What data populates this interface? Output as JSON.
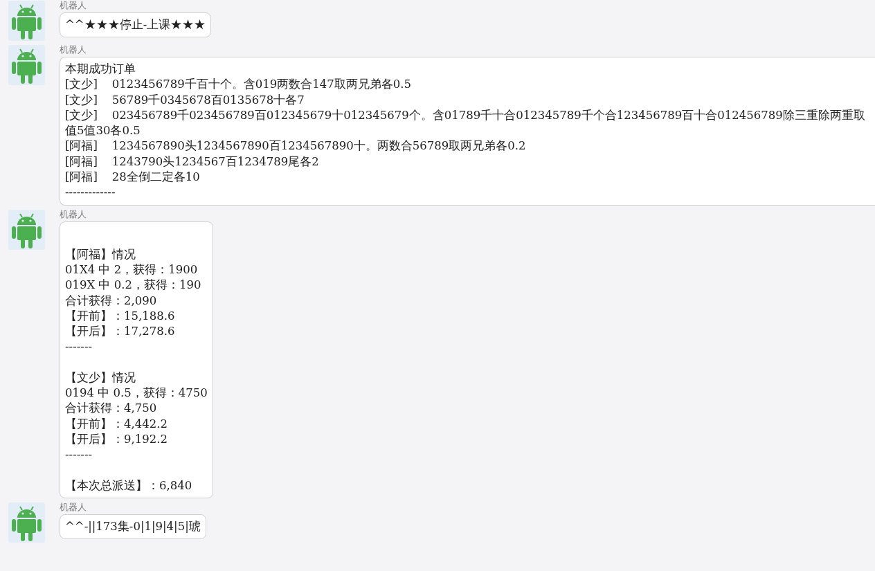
{
  "messages": [
    {
      "sender": "机器人",
      "kind": "text",
      "sections": [
        [
          "^^★★★停止-上课★★★"
        ]
      ]
    },
    {
      "sender": "机器人",
      "kind": "wide",
      "sections": [
        [
          "本期成功订单",
          "[文少]    0123456789千百十个。含019两数合147取两兄弟各0.5",
          "[文少]    56789千0345678百0135678十各7",
          "[文少]    023456789千023456789百012345679十012345679个。含01789千十合012345789千个合123456789百十合012456789除三重除两重取值5值30各0.5",
          "[阿福]    1234567890头1234567890百1234567890十。两数合56789取两兄弟各0.2",
          "[阿福]    1243790头1234567百1234789尾各2",
          "[阿福]    28全倒二定各10",
          "-------------"
        ]
      ]
    },
    {
      "sender": "机器人",
      "kind": "report",
      "sections": [
        [
          "【阿福】情况",
          "01X4 中 2，获得：1900",
          "019X 中 0.2，获得：190",
          "合计获得：2,090",
          "【开前】：15,188.6",
          "【开后】：17,278.6",
          "-------"
        ],
        [
          "【文少】情况",
          "0194 中 0.5，获得：4750",
          "合计获得：4,750",
          "【开前】：4,442.2",
          "【开后】：9,192.2",
          "-------"
        ],
        [
          "【本次总派送】：6,840"
        ]
      ]
    },
    {
      "sender": "机器人",
      "kind": "text",
      "sections": [
        [
          "^^-||173集-0|1|9|4|5|琥"
        ]
      ]
    }
  ]
}
